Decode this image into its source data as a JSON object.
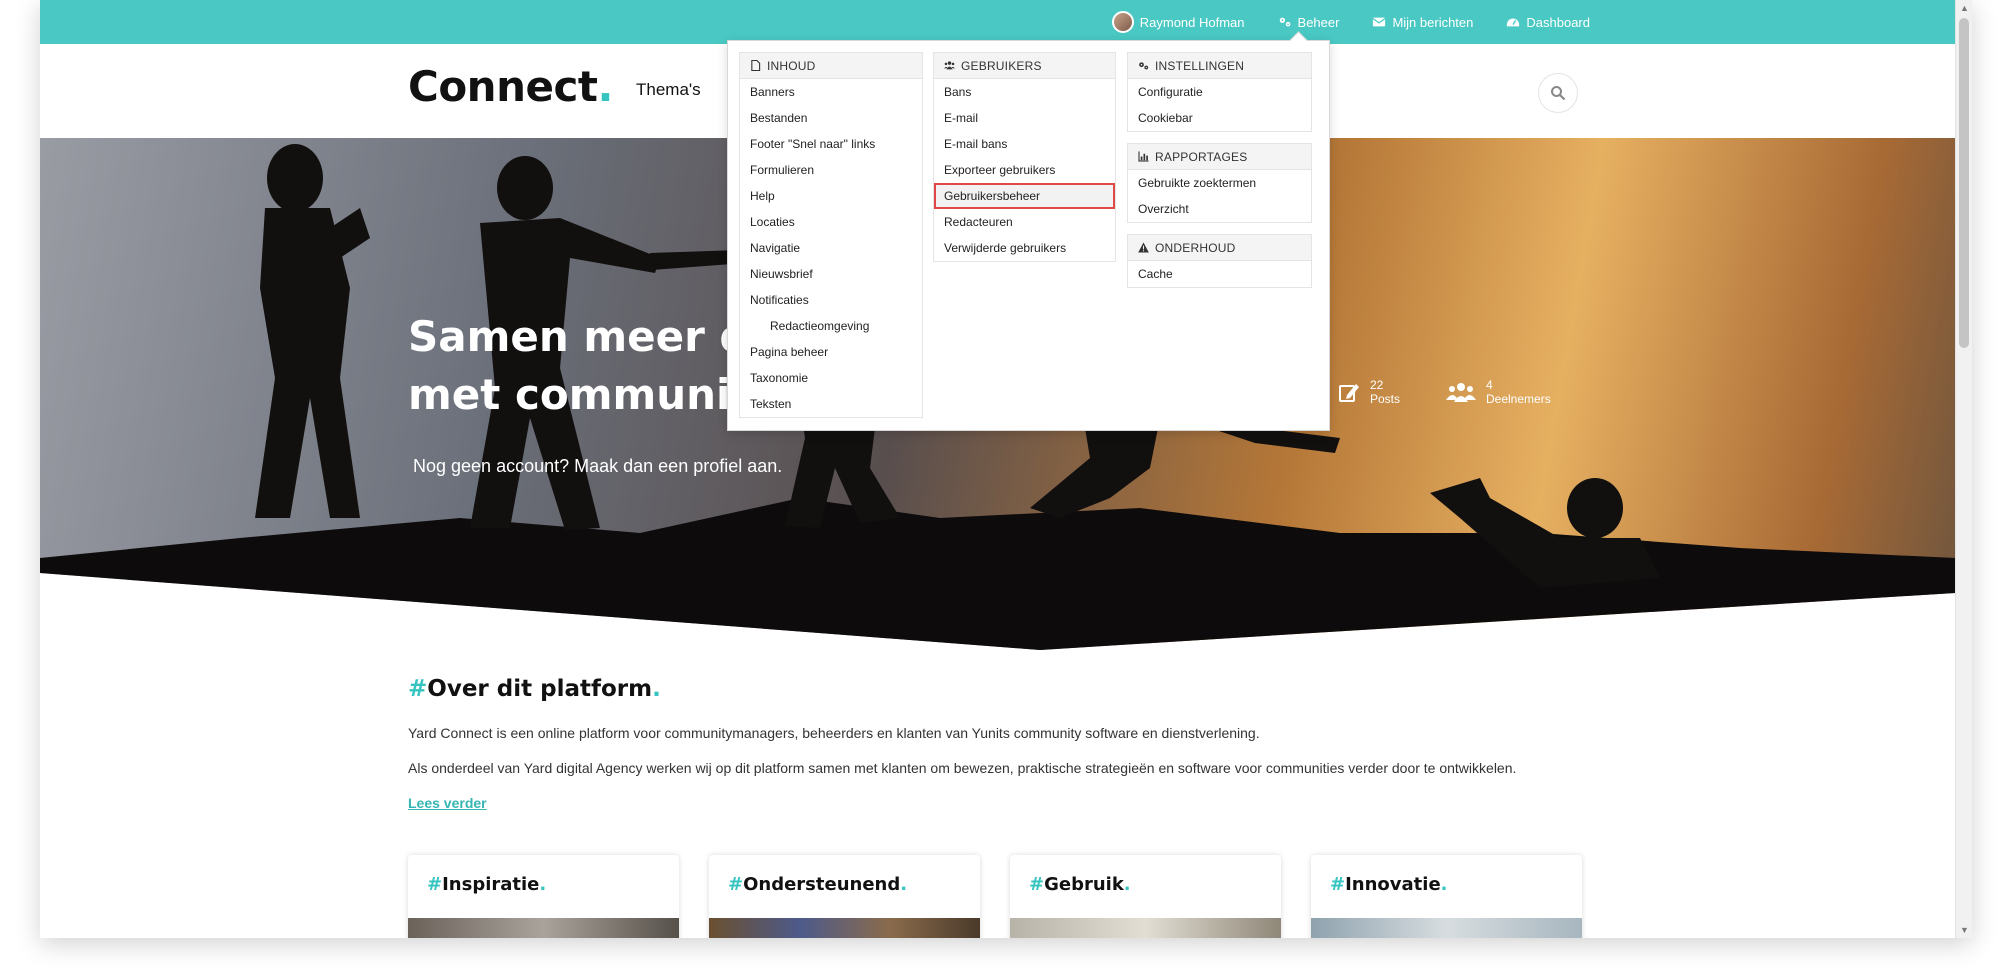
{
  "topbar": {
    "user_name": "Raymond Hofman",
    "beheer_label": "Beheer",
    "messages_label": "Mijn berichten",
    "dashboard_label": "Dashboard"
  },
  "header": {
    "logo_text": "Connect",
    "logo_dot": ".",
    "nav_themas": "Thema's"
  },
  "hero": {
    "title_line1": "Samen meer do",
    "title_line2": "met communitie",
    "subtitle": "Nog geen account? Maak dan een profiel aan.",
    "stats": [
      {
        "value": "22",
        "label": "Posts"
      },
      {
        "value": "4",
        "label": "Deelnemers"
      }
    ]
  },
  "about": {
    "hash": "#",
    "title": "Over dit platform",
    "dot": ".",
    "paragraph1": "Yard Connect is een online platform voor communitymanagers, beheerders en klanten van Yunits community software en dienstverlening.",
    "paragraph2": "Als onderdeel van Yard digital Agency werken wij op dit platform samen met klanten om bewezen, praktische strategieën en software voor communities verder door te ontwikkelen.",
    "read_more": "Lees verder"
  },
  "cards": [
    {
      "title": "Inspiratie"
    },
    {
      "title": "Ondersteunend"
    },
    {
      "title": "Gebruik"
    },
    {
      "title": "Innovatie"
    }
  ],
  "dropdown": {
    "inhoud": {
      "header": "INHOUD",
      "items": [
        "Banners",
        "Bestanden",
        "Footer \"Snel naar\" links",
        "Formulieren",
        "Help",
        "Locaties",
        "Navigatie",
        "Nieuwsbrief",
        "Notificaties",
        "Redactieomgeving",
        "Pagina beheer",
        "Taxonomie",
        "Teksten"
      ]
    },
    "gebruikers": {
      "header": "GEBRUIKERS",
      "items": [
        "Bans",
        "E-mail",
        "E-mail bans",
        "Exporteer gebruikers",
        "Gebruikersbeheer",
        "Redacteuren",
        "Verwijderde gebruikers"
      ],
      "highlighted": "Gebruikersbeheer"
    },
    "instellingen": {
      "header": "INSTELLINGEN",
      "items": [
        "Configuratie",
        "Cookiebar"
      ]
    },
    "rapportages": {
      "header": "RAPPORTAGES",
      "items": [
        "Gebruikte zoektermen",
        "Overzicht"
      ]
    },
    "onderhoud": {
      "header": "ONDERHOUD",
      "items": [
        "Cache"
      ]
    }
  },
  "colors": {
    "accent": "#4ac8c3",
    "highlight_border": "#e04848"
  }
}
